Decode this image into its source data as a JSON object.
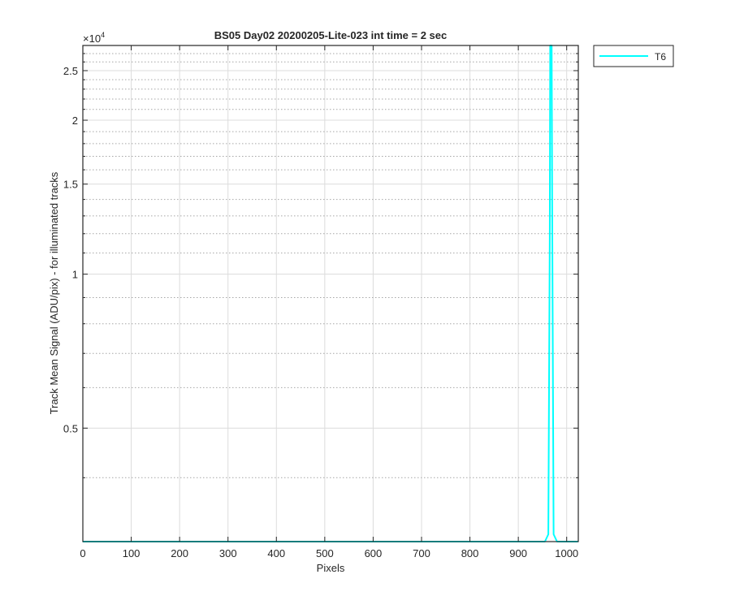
{
  "chart_data": {
    "type": "line",
    "title": "BS05 Day02 20200205-Lite-023 int time = 2 sec",
    "xlabel": "Pixels",
    "ylabel": "Track Mean Signal (ADU/pix) - for illuminated tracks",
    "y_exponent_label": "×10",
    "y_exponent_power": "4",
    "xlim": [
      0,
      1024
    ],
    "ylim": [
      3000,
      28000
    ],
    "y_scale": "log",
    "x_ticks": [
      0,
      100,
      200,
      300,
      400,
      500,
      600,
      700,
      800,
      900,
      1000
    ],
    "x_tick_labels": [
      "0",
      "100",
      "200",
      "300",
      "400",
      "500",
      "600",
      "700",
      "800",
      "900",
      "1000"
    ],
    "y_ticks": [
      5000,
      10000,
      15000,
      20000,
      25000
    ],
    "y_tick_labels": [
      "0.5",
      "1",
      "1.5",
      "2",
      "2.5"
    ],
    "y_minor_ticks": [
      4000,
      6000,
      7000,
      8000,
      9000,
      11000,
      12000,
      13000,
      14000,
      16000,
      17000,
      18000,
      19000,
      21000,
      22000,
      23000,
      24000,
      26000,
      27000
    ],
    "grid": true,
    "legend_position": "outside-top-right",
    "series": [
      {
        "name": "T6",
        "color": "#00ffff",
        "x": [
          0,
          200,
          400,
          600,
          800,
          955,
          962,
          965,
          966,
          967,
          968,
          969,
          970,
          973,
          980,
          1000,
          1023
        ],
        "y": [
          3000,
          3000,
          3000,
          3000,
          3000,
          3000,
          3100,
          12000,
          28000,
          28000,
          28000,
          28000,
          14000,
          3100,
          3000,
          3000,
          3000
        ]
      }
    ]
  }
}
